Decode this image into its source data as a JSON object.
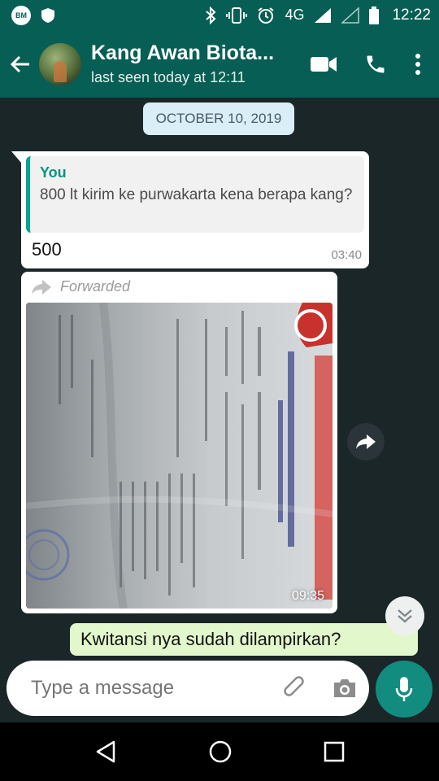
{
  "status_bar": {
    "network": "4G",
    "time": "12:22"
  },
  "header": {
    "contact_name": "Kang Awan Biota...",
    "last_seen": "last seen today at 12:11"
  },
  "chat": {
    "date_chip": "OCTOBER 10, 2019",
    "messages": [
      {
        "quoted_author": "You",
        "quoted_text": "800 lt kirim ke purwakarta kena berapa kang?",
        "text": "500",
        "time": "03:40"
      },
      {
        "forwarded_label": "Forwarded",
        "time": "09:35"
      },
      {
        "text": "Kwitansi nya sudah dilampirkan?"
      }
    ]
  },
  "input": {
    "placeholder": "Type a message"
  },
  "colors": {
    "header": "#075e54",
    "accent": "#128c7e",
    "quote_bar": "#06a38d",
    "outgoing_bubble": "#e2f7cb",
    "chat_background": "#1b2629"
  }
}
